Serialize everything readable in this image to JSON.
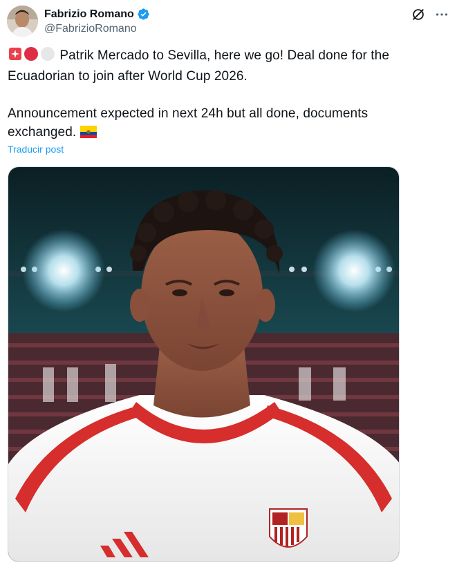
{
  "author": {
    "name": "Fabrizio Romano",
    "handle": "@FabrizioRomano",
    "verified": true,
    "verified_color": "#1d9bf0"
  },
  "tweet": {
    "line1": "Patrik Mercado to Sevilla, here we go! Deal done for the Ecuadorian to join after World Cup 2026.",
    "line2": "Announcement expected in next 24h but all done, documents exchanged.",
    "leading_emojis": [
      "siren-emoji",
      "red-circle-emoji",
      "white-circle-emoji"
    ],
    "trailing_emoji": "ecuador-flag-emoji",
    "translate_label": "Traducir post"
  },
  "icons": {
    "grok": "grok-icon",
    "more": "more-icon",
    "verified": "verified-badge-icon"
  },
  "media": {
    "subject": "player-photo"
  }
}
